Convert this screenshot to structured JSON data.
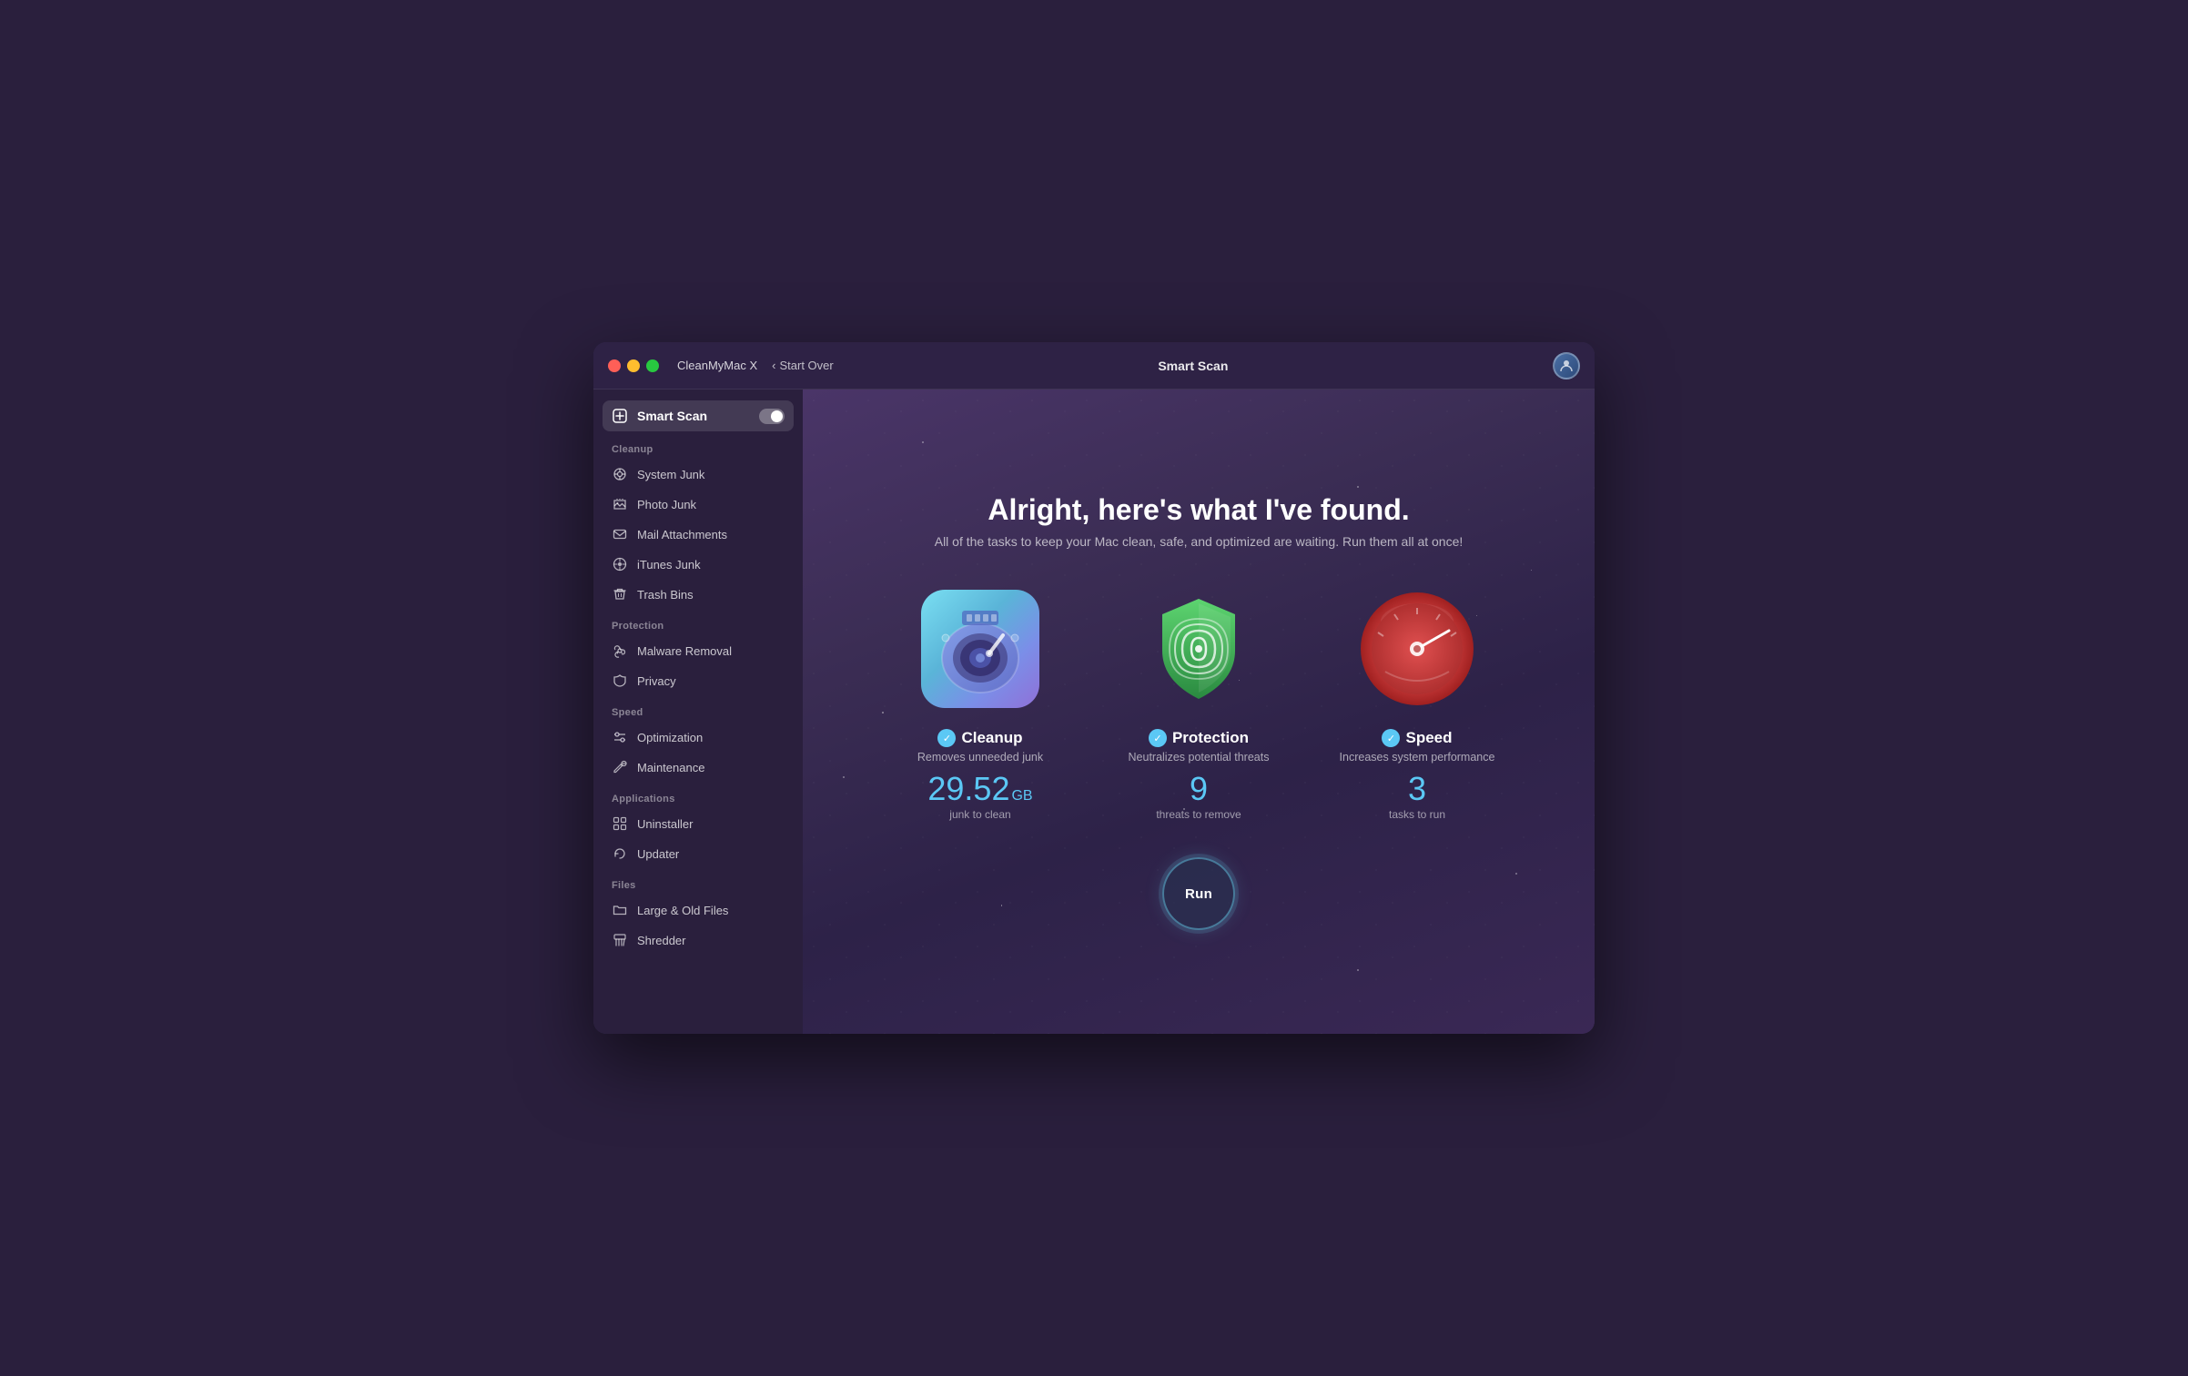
{
  "window": {
    "app_name": "CleanMyMac X",
    "title": "Smart Scan",
    "back_label": "Start Over"
  },
  "sidebar": {
    "active_item": "Smart Scan",
    "sections": [
      {
        "label": "Cleanup",
        "items": [
          {
            "id": "system-junk",
            "label": "System Junk",
            "icon": "disk-icon"
          },
          {
            "id": "photo-junk",
            "label": "Photo Junk",
            "icon": "photo-icon"
          },
          {
            "id": "mail-attachments",
            "label": "Mail Attachments",
            "icon": "mail-icon"
          },
          {
            "id": "itunes-junk",
            "label": "iTunes Junk",
            "icon": "music-icon"
          },
          {
            "id": "trash-bins",
            "label": "Trash Bins",
            "icon": "trash-icon"
          }
        ]
      },
      {
        "label": "Protection",
        "items": [
          {
            "id": "malware-removal",
            "label": "Malware Removal",
            "icon": "biohazard-icon"
          },
          {
            "id": "privacy",
            "label": "Privacy",
            "icon": "hand-icon"
          }
        ]
      },
      {
        "label": "Speed",
        "items": [
          {
            "id": "optimization",
            "label": "Optimization",
            "icon": "sliders-icon"
          },
          {
            "id": "maintenance",
            "label": "Maintenance",
            "icon": "wrench-icon"
          }
        ]
      },
      {
        "label": "Applications",
        "items": [
          {
            "id": "uninstaller",
            "label": "Uninstaller",
            "icon": "grid-icon"
          },
          {
            "id": "updater",
            "label": "Updater",
            "icon": "refresh-icon"
          }
        ]
      },
      {
        "label": "Files",
        "items": [
          {
            "id": "large-old-files",
            "label": "Large & Old Files",
            "icon": "folder-icon"
          },
          {
            "id": "shredder",
            "label": "Shredder",
            "icon": "shredder-icon"
          }
        ]
      }
    ]
  },
  "main": {
    "heading": "Alright, here's what I've found.",
    "subheading": "All of the tasks to keep your Mac clean, safe, and optimized are waiting. Run them all at once!",
    "cards": [
      {
        "id": "cleanup",
        "name": "Cleanup",
        "description": "Removes unneeded junk",
        "value": "29.52",
        "unit_label": "GB",
        "sub_unit": "junk to clean",
        "check_color": "#5bc8f5"
      },
      {
        "id": "protection",
        "name": "Protection",
        "description": "Neutralizes potential threats",
        "value": "9",
        "unit_label": "",
        "sub_unit": "threats to remove",
        "check_color": "#5bc8f5"
      },
      {
        "id": "speed",
        "name": "Speed",
        "description": "Increases system performance",
        "value": "3",
        "unit_label": "",
        "sub_unit": "tasks to run",
        "check_color": "#5bc8f5"
      }
    ],
    "run_button_label": "Run"
  }
}
